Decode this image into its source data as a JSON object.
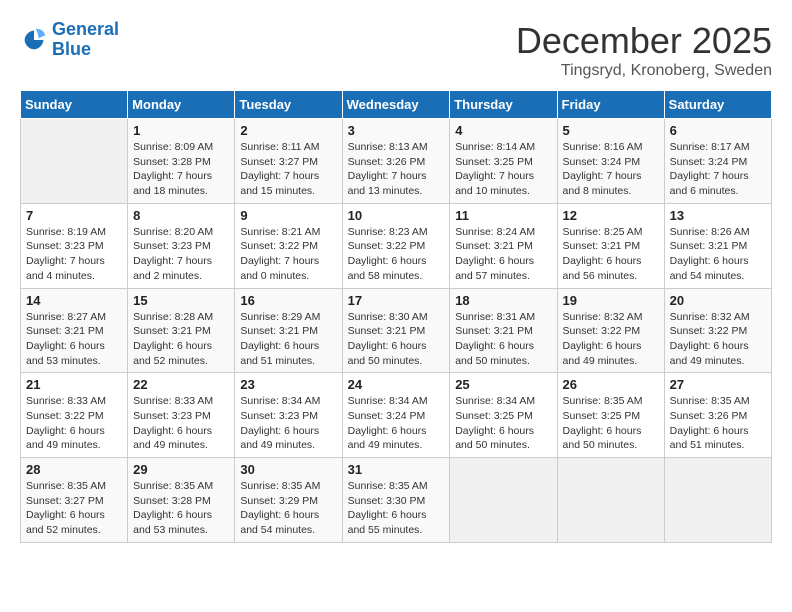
{
  "logo": {
    "line1": "General",
    "line2": "Blue"
  },
  "title": {
    "month": "December 2025",
    "location": "Tingsryd, Kronoberg, Sweden"
  },
  "headers": [
    "Sunday",
    "Monday",
    "Tuesday",
    "Wednesday",
    "Thursday",
    "Friday",
    "Saturday"
  ],
  "weeks": [
    [
      {
        "day": "",
        "info": ""
      },
      {
        "day": "1",
        "info": "Sunrise: 8:09 AM\nSunset: 3:28 PM\nDaylight: 7 hours\nand 18 minutes."
      },
      {
        "day": "2",
        "info": "Sunrise: 8:11 AM\nSunset: 3:27 PM\nDaylight: 7 hours\nand 15 minutes."
      },
      {
        "day": "3",
        "info": "Sunrise: 8:13 AM\nSunset: 3:26 PM\nDaylight: 7 hours\nand 13 minutes."
      },
      {
        "day": "4",
        "info": "Sunrise: 8:14 AM\nSunset: 3:25 PM\nDaylight: 7 hours\nand 10 minutes."
      },
      {
        "day": "5",
        "info": "Sunrise: 8:16 AM\nSunset: 3:24 PM\nDaylight: 7 hours\nand 8 minutes."
      },
      {
        "day": "6",
        "info": "Sunrise: 8:17 AM\nSunset: 3:24 PM\nDaylight: 7 hours\nand 6 minutes."
      }
    ],
    [
      {
        "day": "7",
        "info": "Sunrise: 8:19 AM\nSunset: 3:23 PM\nDaylight: 7 hours\nand 4 minutes."
      },
      {
        "day": "8",
        "info": "Sunrise: 8:20 AM\nSunset: 3:23 PM\nDaylight: 7 hours\nand 2 minutes."
      },
      {
        "day": "9",
        "info": "Sunrise: 8:21 AM\nSunset: 3:22 PM\nDaylight: 7 hours\nand 0 minutes."
      },
      {
        "day": "10",
        "info": "Sunrise: 8:23 AM\nSunset: 3:22 PM\nDaylight: 6 hours\nand 58 minutes."
      },
      {
        "day": "11",
        "info": "Sunrise: 8:24 AM\nSunset: 3:21 PM\nDaylight: 6 hours\nand 57 minutes."
      },
      {
        "day": "12",
        "info": "Sunrise: 8:25 AM\nSunset: 3:21 PM\nDaylight: 6 hours\nand 56 minutes."
      },
      {
        "day": "13",
        "info": "Sunrise: 8:26 AM\nSunset: 3:21 PM\nDaylight: 6 hours\nand 54 minutes."
      }
    ],
    [
      {
        "day": "14",
        "info": "Sunrise: 8:27 AM\nSunset: 3:21 PM\nDaylight: 6 hours\nand 53 minutes."
      },
      {
        "day": "15",
        "info": "Sunrise: 8:28 AM\nSunset: 3:21 PM\nDaylight: 6 hours\nand 52 minutes."
      },
      {
        "day": "16",
        "info": "Sunrise: 8:29 AM\nSunset: 3:21 PM\nDaylight: 6 hours\nand 51 minutes."
      },
      {
        "day": "17",
        "info": "Sunrise: 8:30 AM\nSunset: 3:21 PM\nDaylight: 6 hours\nand 50 minutes."
      },
      {
        "day": "18",
        "info": "Sunrise: 8:31 AM\nSunset: 3:21 PM\nDaylight: 6 hours\nand 50 minutes."
      },
      {
        "day": "19",
        "info": "Sunrise: 8:32 AM\nSunset: 3:22 PM\nDaylight: 6 hours\nand 49 minutes."
      },
      {
        "day": "20",
        "info": "Sunrise: 8:32 AM\nSunset: 3:22 PM\nDaylight: 6 hours\nand 49 minutes."
      }
    ],
    [
      {
        "day": "21",
        "info": "Sunrise: 8:33 AM\nSunset: 3:22 PM\nDaylight: 6 hours\nand 49 minutes."
      },
      {
        "day": "22",
        "info": "Sunrise: 8:33 AM\nSunset: 3:23 PM\nDaylight: 6 hours\nand 49 minutes."
      },
      {
        "day": "23",
        "info": "Sunrise: 8:34 AM\nSunset: 3:23 PM\nDaylight: 6 hours\nand 49 minutes."
      },
      {
        "day": "24",
        "info": "Sunrise: 8:34 AM\nSunset: 3:24 PM\nDaylight: 6 hours\nand 49 minutes."
      },
      {
        "day": "25",
        "info": "Sunrise: 8:34 AM\nSunset: 3:25 PM\nDaylight: 6 hours\nand 50 minutes."
      },
      {
        "day": "26",
        "info": "Sunrise: 8:35 AM\nSunset: 3:25 PM\nDaylight: 6 hours\nand 50 minutes."
      },
      {
        "day": "27",
        "info": "Sunrise: 8:35 AM\nSunset: 3:26 PM\nDaylight: 6 hours\nand 51 minutes."
      }
    ],
    [
      {
        "day": "28",
        "info": "Sunrise: 8:35 AM\nSunset: 3:27 PM\nDaylight: 6 hours\nand 52 minutes."
      },
      {
        "day": "29",
        "info": "Sunrise: 8:35 AM\nSunset: 3:28 PM\nDaylight: 6 hours\nand 53 minutes."
      },
      {
        "day": "30",
        "info": "Sunrise: 8:35 AM\nSunset: 3:29 PM\nDaylight: 6 hours\nand 54 minutes."
      },
      {
        "day": "31",
        "info": "Sunrise: 8:35 AM\nSunset: 3:30 PM\nDaylight: 6 hours\nand 55 minutes."
      },
      {
        "day": "",
        "info": ""
      },
      {
        "day": "",
        "info": ""
      },
      {
        "day": "",
        "info": ""
      }
    ]
  ]
}
